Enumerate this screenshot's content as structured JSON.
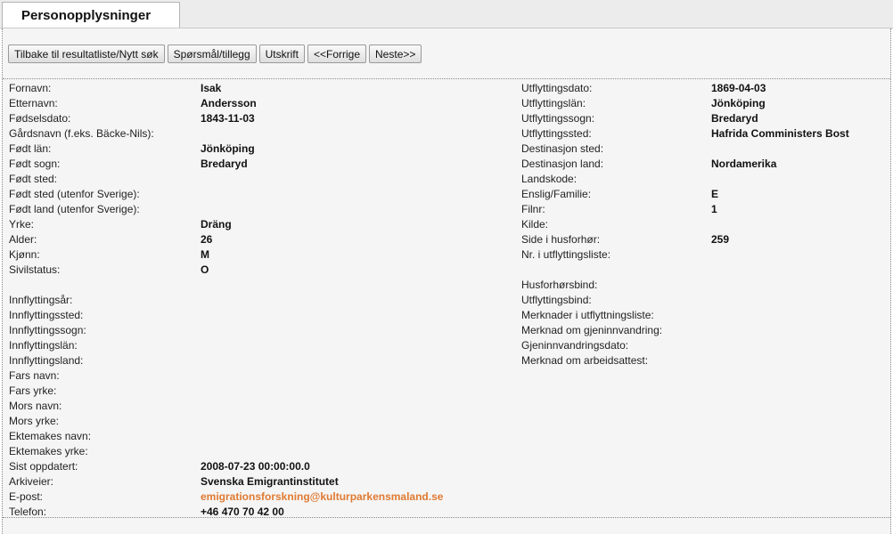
{
  "tab": {
    "title": "Personopplysninger"
  },
  "toolbar": {
    "back_label": "Tilbake til resultatliste/Nytt søk",
    "questions_label": "Spørsmål/tillegg",
    "print_label": "Utskrift",
    "prev_label": "<<Forrige",
    "next_label": "Neste>>"
  },
  "left": {
    "fornavn": {
      "label": "Fornavn:",
      "value": "Isak"
    },
    "etternavn": {
      "label": "Etternavn:",
      "value": "Andersson"
    },
    "fodselsdato": {
      "label": "Fødselsdato:",
      "value": "1843-11-03"
    },
    "gardsnavn": {
      "label": "Gårdsnavn (f.eks. Bäcke-Nils):",
      "value": ""
    },
    "fodt_lan": {
      "label": "Født län:",
      "value": "Jönköping"
    },
    "fodt_sogn": {
      "label": "Født sogn:",
      "value": "Bredaryd"
    },
    "fodt_sted": {
      "label": "Født sted:",
      "value": ""
    },
    "fodt_sted_utenfor": {
      "label": "Født sted (utenfor Sverige):",
      "value": ""
    },
    "fodt_land_utenfor": {
      "label": "Født land (utenfor Sverige):",
      "value": ""
    },
    "yrke": {
      "label": "Yrke:",
      "value": "Dräng"
    },
    "alder": {
      "label": "Alder:",
      "value": "26"
    },
    "kjonn": {
      "label": "Kjønn:",
      "value": "M"
    },
    "sivilstatus": {
      "label": "Sivilstatus:",
      "value": "O"
    },
    "innflyttingsar": {
      "label": "Innflyttingsår:",
      "value": ""
    },
    "innflyttingssted": {
      "label": "Innflyttingssted:",
      "value": ""
    },
    "innflyttingssogn": {
      "label": "Innflyttingssogn:",
      "value": ""
    },
    "innflyttingslan": {
      "label": "Innflyttingslän:",
      "value": ""
    },
    "innflyttingsland": {
      "label": "Innflyttingsland:",
      "value": ""
    },
    "fars_navn": {
      "label": "Fars navn:",
      "value": ""
    },
    "fars_yrke": {
      "label": "Fars yrke:",
      "value": ""
    },
    "mors_navn": {
      "label": "Mors navn:",
      "value": ""
    },
    "mors_yrke": {
      "label": "Mors yrke:",
      "value": ""
    },
    "ektemakes_navn": {
      "label": "Ektemakes navn:",
      "value": ""
    },
    "ektemakes_yrke": {
      "label": "Ektemakes yrke:",
      "value": ""
    },
    "sist_oppdatert": {
      "label": "Sist oppdatert:",
      "value": "2008-07-23 00:00:00.0"
    },
    "arkiveier": {
      "label": "Arkiveier:",
      "value": "Svenska Emigrantinstitutet"
    },
    "epost": {
      "label": "E-post:",
      "value": "emigrationsforskning@kulturparkensmaland.se"
    },
    "telefon": {
      "label": "Telefon:",
      "value": "+46 470 70 42 00"
    }
  },
  "right": {
    "utflyttingsdato": {
      "label": "Utflyttingsdato:",
      "value": "1869-04-03"
    },
    "utflyttingslan": {
      "label": "Utflyttingslän:",
      "value": "Jönköping"
    },
    "utflyttingssogn": {
      "label": "Utflyttingssogn:",
      "value": "Bredaryd"
    },
    "utflyttingssted": {
      "label": "Utflyttingssted:",
      "value": "Hafrida Comministers Bost"
    },
    "destinasjon_sted": {
      "label": "Destinasjon sted:",
      "value": ""
    },
    "destinasjon_land": {
      "label": "Destinasjon land:",
      "value": "Nordamerika"
    },
    "landskode": {
      "label": "Landskode:",
      "value": ""
    },
    "enslig_familie": {
      "label": "Enslig/Familie:",
      "value": "E"
    },
    "filnr": {
      "label": "Filnr:",
      "value": "1"
    },
    "kilde": {
      "label": "Kilde:",
      "value": ""
    },
    "side_husforhor": {
      "label": "Side i husforhør:",
      "value": "259"
    },
    "nr_utflyttingsliste": {
      "label": "Nr. i utflyttingsliste:",
      "value": ""
    },
    "husforhorsbind": {
      "label": "Husforhørsbind:",
      "value": ""
    },
    "utflyttingsbind": {
      "label": "Utflyttingsbind:",
      "value": ""
    },
    "merknader_utflytningsliste": {
      "label": "Merknader i utflyttningsliste:",
      "value": ""
    },
    "merknad_gjeninnvandring": {
      "label": "Merknad om gjeninnvandring:",
      "value": ""
    },
    "gjeninnvandringsdato": {
      "label": "Gjeninnvandringsdato:",
      "value": ""
    },
    "merknad_arbeidsattest": {
      "label": "Merknad om arbeidsattest:",
      "value": ""
    }
  }
}
